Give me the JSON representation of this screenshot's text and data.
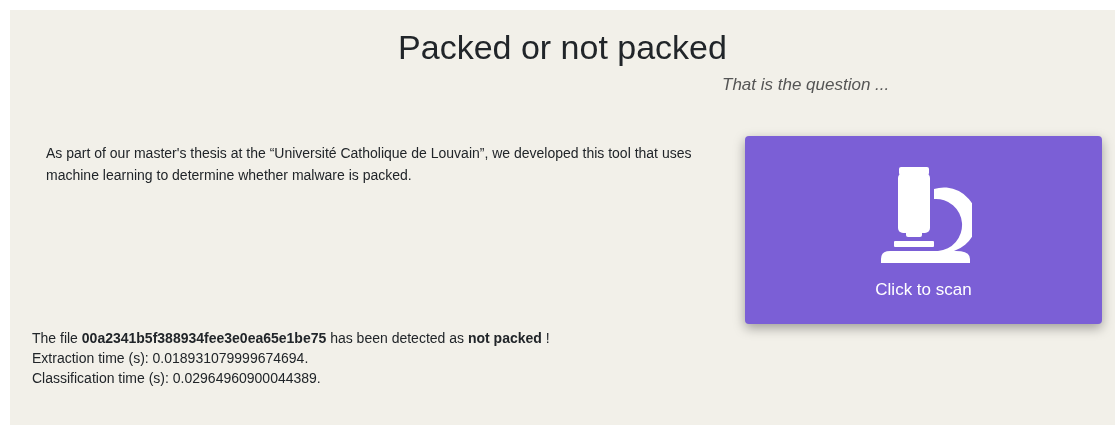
{
  "title": "Packed or not packed",
  "subtitle": "That is the question ...",
  "description": "As part of our master's thesis at the “Université Catholique de Louvain”, we developed this tool that uses machine learning to determine whether malware is packed.",
  "scan_button": {
    "label": "Click to scan"
  },
  "result": [
    "The file **00a2341b5f388934fee3e0ea65e1be75** has been detected as **not packed** !",
    "Extraction time (s): 0.018931079999674694.",
    "Classification time (s): 0.02964960900044389."
  ]
}
